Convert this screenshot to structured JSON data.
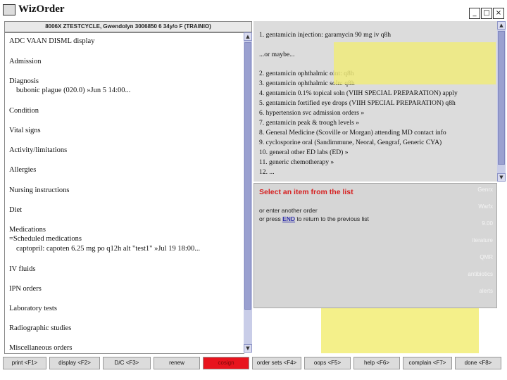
{
  "window": {
    "title": "WizOrder",
    "minimize_glyph": "_",
    "maximize_glyph": "□",
    "close_glyph": "×"
  },
  "patient_bar": "8006X ZTESTCYCLE, Gwendolyn 3006850 6 34y/o F (TRAINIO)",
  "left_pane": {
    "items": [
      "ADC VAAN DISML display",
      "Admission",
      "Diagnosis",
      "bubonic plague (020.0) »Jun 5 14:00...",
      "Condition",
      "Vital signs",
      "Activity/limitations",
      "Allergies",
      "Nursing instructions",
      "Diet",
      "Medications",
      "=Scheduled medications",
      "captopril: capoten 6.25 mg po q12h alt \"test1\" »Jul 19 18:00...",
      "IV fluids",
      "IPN orders",
      "Laboratory tests",
      "Radiographic studies",
      "Miscellaneous orders"
    ]
  },
  "right_top": {
    "lines": [
      "1. gentamicin injection: garamycin 90 mg iv q8h",
      "...or maybe...",
      "2. gentamicin ophthalmic oint: q8h",
      "3. gentamicin ophthalmic soln: q8h",
      "4. gentamicin 0.1% topical soln (VIIH SPECIAL PREPARATION) apply",
      "5. gentamicin fortified eye drops (VIIH SPECIAL PREPARATION) q8h",
      "6. hypertension svc admission orders »",
      "7. gentamicin peak & trough levels »",
      "8. General Medicine (Scoville or Morgan) attending MD contact info",
      "9. cyclosporine oral (Sandimmune, Neoral, Gengraf, Generic CYA)",
      "10. general other ED labs (ED) »",
      "11. generic chemotherapy »",
      "12. ..."
    ]
  },
  "right_bottom": {
    "title": "Select an item from the list",
    "line1": "or enter another order",
    "line2_pre": "or press ",
    "line2_link": "END",
    "line2_post": " to return to the previous list",
    "side_buttons": [
      "Genrx",
      "Warfx",
      "9.00",
      "iterature",
      "QMR",
      "antibiotics",
      "alerts"
    ]
  },
  "fkeys": [
    "print <F1>",
    "display <F2>",
    "D/C <F3>",
    "renew",
    "cosign",
    "order sets <F4>",
    "oops <F5>",
    "help <F6>",
    "complain <F7>",
    "done <F8>"
  ],
  "colors": {
    "accent_red": "#e8141e",
    "highlight_yellow": "#f0ec78",
    "scrollbar": "#c9cde8",
    "prompt_red": "#d62020"
  }
}
